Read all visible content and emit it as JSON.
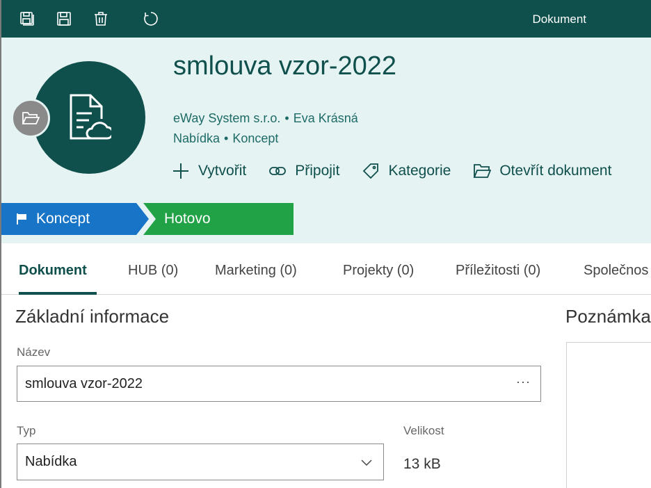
{
  "topbar": {
    "title": "Dokument",
    "icons": [
      "save-close-icon",
      "save-icon",
      "delete-icon",
      "refresh-icon"
    ],
    "bg_color": "#0f4f4c"
  },
  "header": {
    "title": "smlouva vzor-2022",
    "company": "eWay System s.r.o.",
    "owner": "Eva Krásná",
    "doc_type": "Nabídka",
    "state": "Koncept",
    "separator": "•",
    "avatar_icon": "document-cloud-icon",
    "badge_icon": "folder-open-icon",
    "bg_color": "#e5f3f3"
  },
  "actions": [
    {
      "label": "Vytvořit",
      "icon": "plus-icon"
    },
    {
      "label": "Připojit",
      "icon": "link-icon"
    },
    {
      "label": "Kategorie",
      "icon": "tag-icon"
    },
    {
      "label": "Otevřít dokument",
      "icon": "folder-open-icon"
    }
  ],
  "stages": [
    {
      "label": "Koncept",
      "icon": "flag-icon",
      "color": "#1774c7",
      "current": true
    },
    {
      "label": "Hotovo",
      "color": "#22a246",
      "current": false
    }
  ],
  "tabs": [
    {
      "label": "Dokument",
      "active": true
    },
    {
      "label": "HUB (0)"
    },
    {
      "label": "Marketing (0)"
    },
    {
      "label": "Projekty (0)"
    },
    {
      "label": "Příležitosti (0)"
    },
    {
      "label": "Společnos"
    }
  ],
  "form": {
    "section_title": "Základní informace",
    "name_label": "Název",
    "name_value": "smlouva vzor-2022",
    "more_label": "···",
    "type_label": "Typ",
    "type_value": "Nabídka",
    "size_label": "Velikost",
    "size_value": "13 kB"
  },
  "notes": {
    "title": "Poznámka"
  }
}
